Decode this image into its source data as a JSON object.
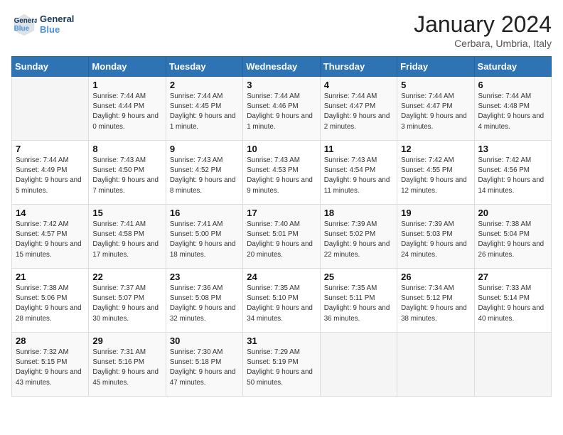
{
  "header": {
    "logo_line1": "General",
    "logo_line2": "Blue",
    "month_title": "January 2024",
    "location": "Cerbara, Umbria, Italy"
  },
  "days_of_week": [
    "Sunday",
    "Monday",
    "Tuesday",
    "Wednesday",
    "Thursday",
    "Friday",
    "Saturday"
  ],
  "weeks": [
    [
      {
        "day": "",
        "sunrise": "",
        "sunset": "",
        "daylight": ""
      },
      {
        "day": "1",
        "sunrise": "Sunrise: 7:44 AM",
        "sunset": "Sunset: 4:44 PM",
        "daylight": "Daylight: 9 hours and 0 minutes."
      },
      {
        "day": "2",
        "sunrise": "Sunrise: 7:44 AM",
        "sunset": "Sunset: 4:45 PM",
        "daylight": "Daylight: 9 hours and 1 minute."
      },
      {
        "day": "3",
        "sunrise": "Sunrise: 7:44 AM",
        "sunset": "Sunset: 4:46 PM",
        "daylight": "Daylight: 9 hours and 1 minute."
      },
      {
        "day": "4",
        "sunrise": "Sunrise: 7:44 AM",
        "sunset": "Sunset: 4:47 PM",
        "daylight": "Daylight: 9 hours and 2 minutes."
      },
      {
        "day": "5",
        "sunrise": "Sunrise: 7:44 AM",
        "sunset": "Sunset: 4:47 PM",
        "daylight": "Daylight: 9 hours and 3 minutes."
      },
      {
        "day": "6",
        "sunrise": "Sunrise: 7:44 AM",
        "sunset": "Sunset: 4:48 PM",
        "daylight": "Daylight: 9 hours and 4 minutes."
      }
    ],
    [
      {
        "day": "7",
        "sunrise": "Sunrise: 7:44 AM",
        "sunset": "Sunset: 4:49 PM",
        "daylight": "Daylight: 9 hours and 5 minutes."
      },
      {
        "day": "8",
        "sunrise": "Sunrise: 7:43 AM",
        "sunset": "Sunset: 4:50 PM",
        "daylight": "Daylight: 9 hours and 7 minutes."
      },
      {
        "day": "9",
        "sunrise": "Sunrise: 7:43 AM",
        "sunset": "Sunset: 4:52 PM",
        "daylight": "Daylight: 9 hours and 8 minutes."
      },
      {
        "day": "10",
        "sunrise": "Sunrise: 7:43 AM",
        "sunset": "Sunset: 4:53 PM",
        "daylight": "Daylight: 9 hours and 9 minutes."
      },
      {
        "day": "11",
        "sunrise": "Sunrise: 7:43 AM",
        "sunset": "Sunset: 4:54 PM",
        "daylight": "Daylight: 9 hours and 11 minutes."
      },
      {
        "day": "12",
        "sunrise": "Sunrise: 7:42 AM",
        "sunset": "Sunset: 4:55 PM",
        "daylight": "Daylight: 9 hours and 12 minutes."
      },
      {
        "day": "13",
        "sunrise": "Sunrise: 7:42 AM",
        "sunset": "Sunset: 4:56 PM",
        "daylight": "Daylight: 9 hours and 14 minutes."
      }
    ],
    [
      {
        "day": "14",
        "sunrise": "Sunrise: 7:42 AM",
        "sunset": "Sunset: 4:57 PM",
        "daylight": "Daylight: 9 hours and 15 minutes."
      },
      {
        "day": "15",
        "sunrise": "Sunrise: 7:41 AM",
        "sunset": "Sunset: 4:58 PM",
        "daylight": "Daylight: 9 hours and 17 minutes."
      },
      {
        "day": "16",
        "sunrise": "Sunrise: 7:41 AM",
        "sunset": "Sunset: 5:00 PM",
        "daylight": "Daylight: 9 hours and 18 minutes."
      },
      {
        "day": "17",
        "sunrise": "Sunrise: 7:40 AM",
        "sunset": "Sunset: 5:01 PM",
        "daylight": "Daylight: 9 hours and 20 minutes."
      },
      {
        "day": "18",
        "sunrise": "Sunrise: 7:39 AM",
        "sunset": "Sunset: 5:02 PM",
        "daylight": "Daylight: 9 hours and 22 minutes."
      },
      {
        "day": "19",
        "sunrise": "Sunrise: 7:39 AM",
        "sunset": "Sunset: 5:03 PM",
        "daylight": "Daylight: 9 hours and 24 minutes."
      },
      {
        "day": "20",
        "sunrise": "Sunrise: 7:38 AM",
        "sunset": "Sunset: 5:04 PM",
        "daylight": "Daylight: 9 hours and 26 minutes."
      }
    ],
    [
      {
        "day": "21",
        "sunrise": "Sunrise: 7:38 AM",
        "sunset": "Sunset: 5:06 PM",
        "daylight": "Daylight: 9 hours and 28 minutes."
      },
      {
        "day": "22",
        "sunrise": "Sunrise: 7:37 AM",
        "sunset": "Sunset: 5:07 PM",
        "daylight": "Daylight: 9 hours and 30 minutes."
      },
      {
        "day": "23",
        "sunrise": "Sunrise: 7:36 AM",
        "sunset": "Sunset: 5:08 PM",
        "daylight": "Daylight: 9 hours and 32 minutes."
      },
      {
        "day": "24",
        "sunrise": "Sunrise: 7:35 AM",
        "sunset": "Sunset: 5:10 PM",
        "daylight": "Daylight: 9 hours and 34 minutes."
      },
      {
        "day": "25",
        "sunrise": "Sunrise: 7:35 AM",
        "sunset": "Sunset: 5:11 PM",
        "daylight": "Daylight: 9 hours and 36 minutes."
      },
      {
        "day": "26",
        "sunrise": "Sunrise: 7:34 AM",
        "sunset": "Sunset: 5:12 PM",
        "daylight": "Daylight: 9 hours and 38 minutes."
      },
      {
        "day": "27",
        "sunrise": "Sunrise: 7:33 AM",
        "sunset": "Sunset: 5:14 PM",
        "daylight": "Daylight: 9 hours and 40 minutes."
      }
    ],
    [
      {
        "day": "28",
        "sunrise": "Sunrise: 7:32 AM",
        "sunset": "Sunset: 5:15 PM",
        "daylight": "Daylight: 9 hours and 43 minutes."
      },
      {
        "day": "29",
        "sunrise": "Sunrise: 7:31 AM",
        "sunset": "Sunset: 5:16 PM",
        "daylight": "Daylight: 9 hours and 45 minutes."
      },
      {
        "day": "30",
        "sunrise": "Sunrise: 7:30 AM",
        "sunset": "Sunset: 5:18 PM",
        "daylight": "Daylight: 9 hours and 47 minutes."
      },
      {
        "day": "31",
        "sunrise": "Sunrise: 7:29 AM",
        "sunset": "Sunset: 5:19 PM",
        "daylight": "Daylight: 9 hours and 50 minutes."
      },
      {
        "day": "",
        "sunrise": "",
        "sunset": "",
        "daylight": ""
      },
      {
        "day": "",
        "sunrise": "",
        "sunset": "",
        "daylight": ""
      },
      {
        "day": "",
        "sunrise": "",
        "sunset": "",
        "daylight": ""
      }
    ]
  ]
}
